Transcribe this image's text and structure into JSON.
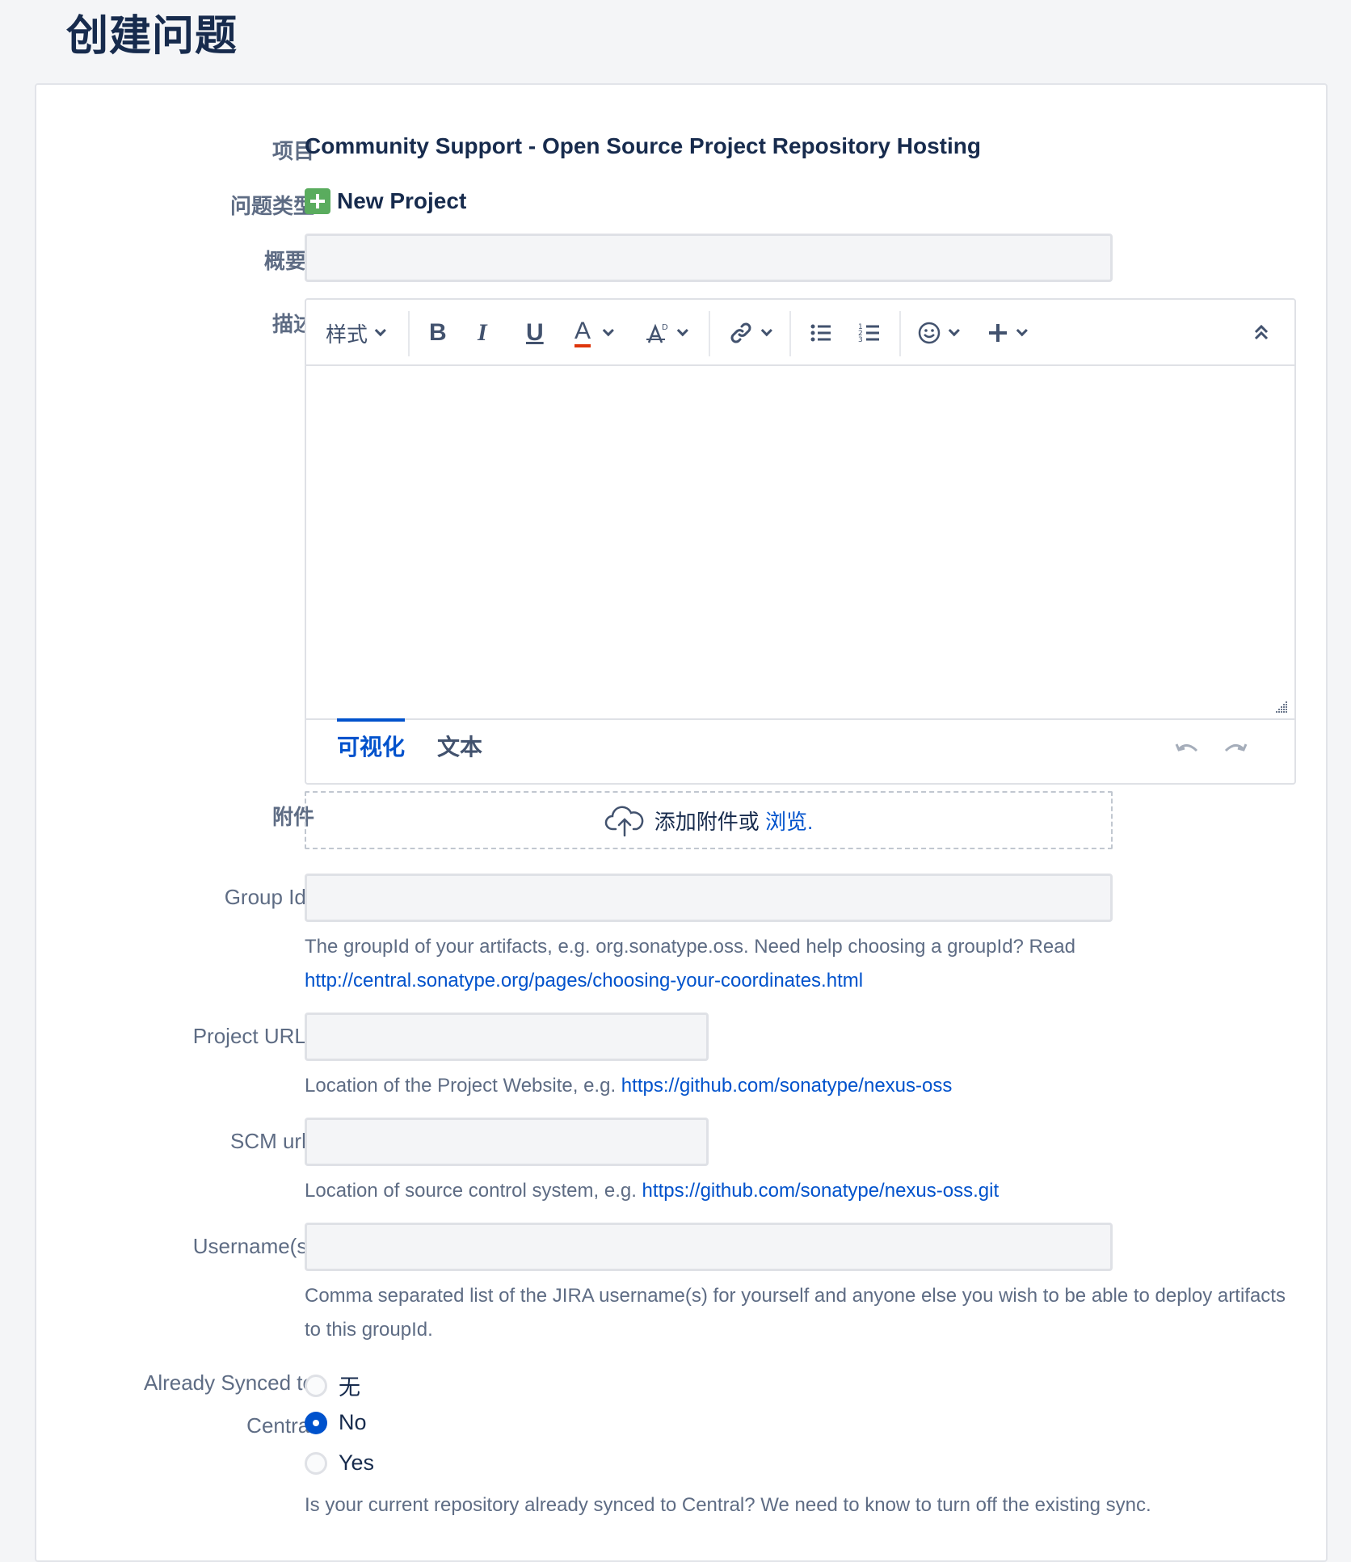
{
  "page": {
    "title": "创建问题"
  },
  "form": {
    "project": {
      "label": "项目",
      "value": "Community Support - Open Source Project Repository Hosting"
    },
    "issue_type": {
      "label": "问题类型",
      "value": "New Project",
      "icon": "green-plus-icon"
    },
    "summary": {
      "label": "概要",
      "required_mark": "*",
      "value": ""
    },
    "description": {
      "label": "描述",
      "toolbar": {
        "style_label": "样式",
        "bold": "B",
        "italic": "I",
        "underline": "U",
        "text_color": "A",
        "text_color_accent": "#de350b"
      },
      "tabs": [
        {
          "label": "可视化",
          "active": true
        },
        {
          "label": "文本",
          "active": false
        }
      ]
    },
    "attachment": {
      "label": "附件",
      "drop_text": "添加附件或",
      "browse_link": "浏览."
    },
    "group_id": {
      "label": "Group Id",
      "required_mark": "*",
      "value": "",
      "help": "The groupId of your artifacts, e.g. org.sonatype.oss. Need help choosing a groupId? Read",
      "help_link": "http://central.sonatype.org/pages/choosing-your-coordinates.html"
    },
    "project_url": {
      "label": "Project URL",
      "required_mark": "*",
      "value": "",
      "help": "Location of the Project Website, e.g.",
      "help_link": "https://github.com/sonatype/nexus-oss"
    },
    "scm_url": {
      "label": "SCM url",
      "required_mark": "*",
      "value": "",
      "help": "Location of source control system, e.g.",
      "help_link": "https://github.com/sonatype/nexus-oss.git"
    },
    "usernames": {
      "label": "Username(s)",
      "value": "",
      "help": "Comma separated list of the JIRA username(s) for yourself and anyone else you wish to be able to deploy artifacts to this groupId."
    },
    "already_synced": {
      "label_line1": "Already Synced to",
      "label_line2": "Central",
      "options": [
        {
          "label": "无",
          "checked": false
        },
        {
          "label": "No",
          "checked": true
        },
        {
          "label": "Yes",
          "checked": false
        }
      ],
      "help": "Is your current repository already synced to Central? We need to know to turn off the existing sync."
    }
  },
  "colors": {
    "accent": "#0052cc",
    "required": "#de350b",
    "issue_type_icon": "#5aac5e"
  }
}
